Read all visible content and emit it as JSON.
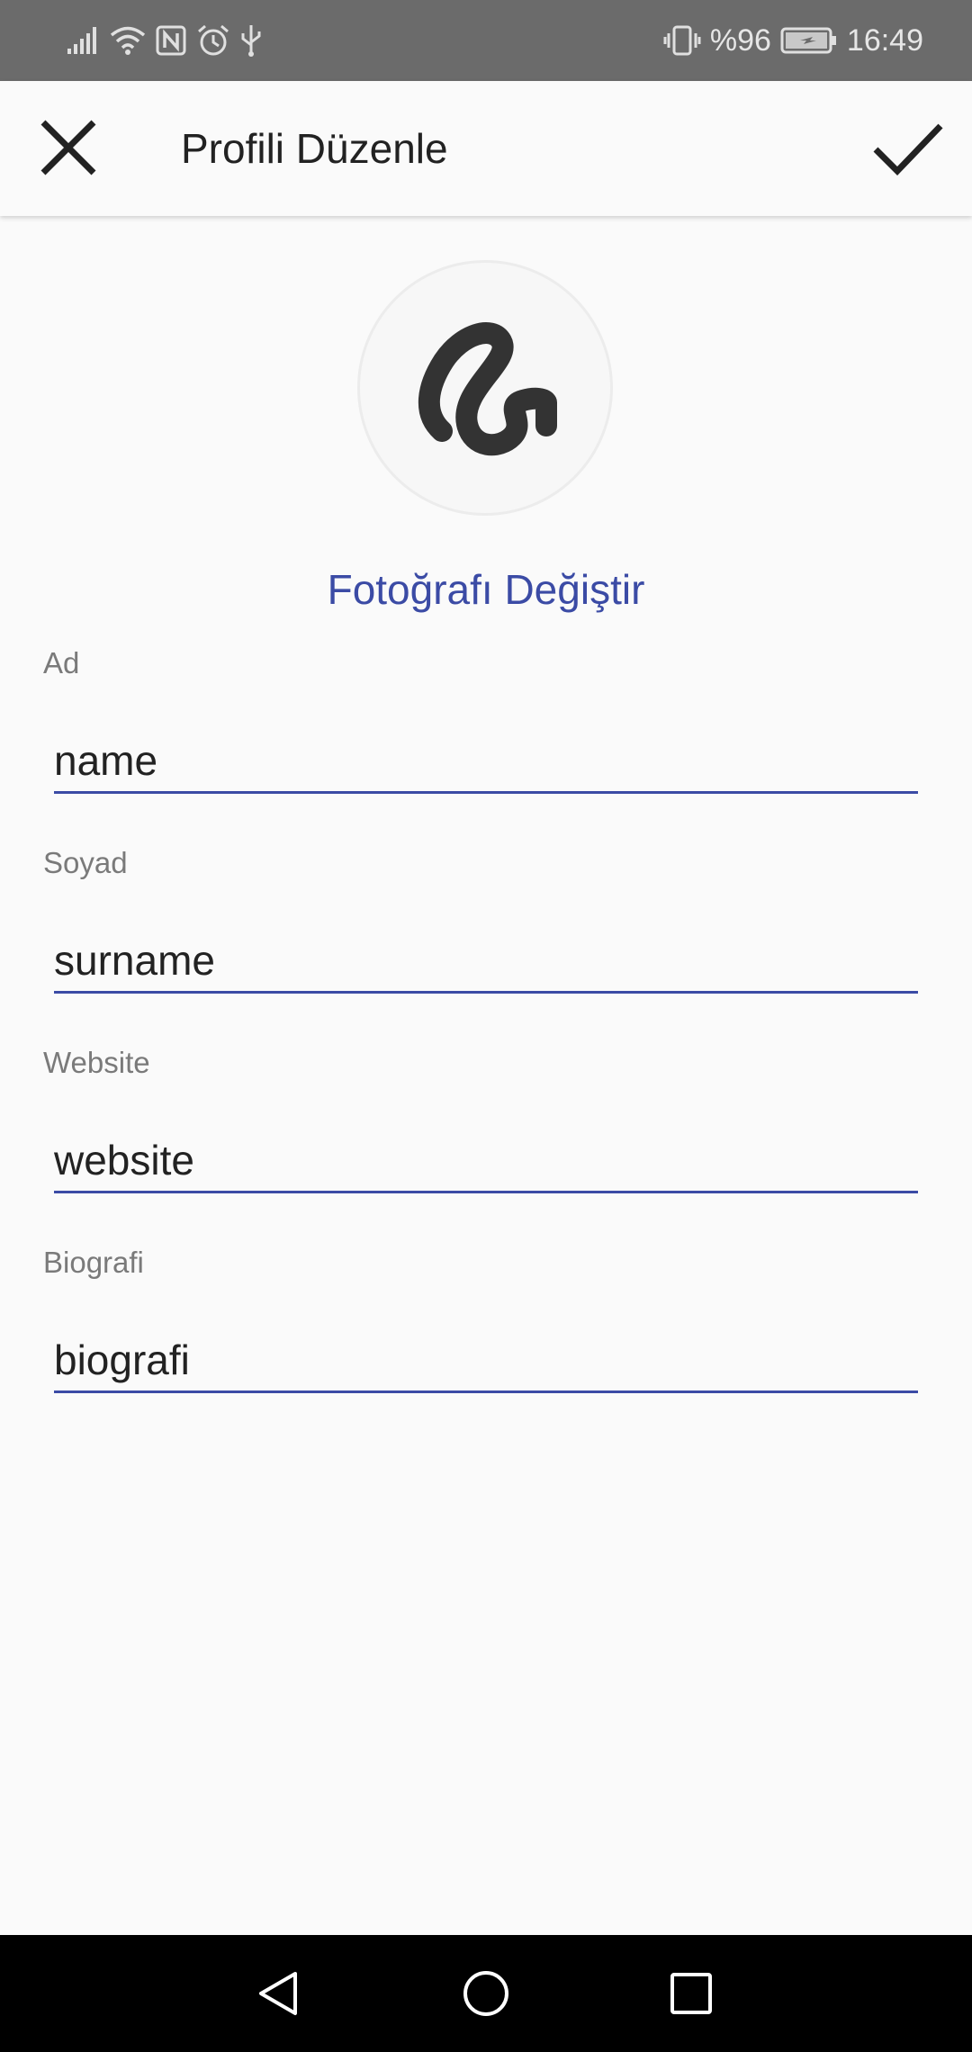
{
  "status_bar": {
    "battery": "%96",
    "time": "16:49",
    "icons": [
      "signal-icon",
      "wifi-icon",
      "nfc-icon",
      "alarm-icon",
      "usb-icon",
      "vibrate-icon",
      "battery-charging-icon"
    ]
  },
  "app_bar": {
    "title": "Profili Düzenle",
    "close_icon": "close-icon",
    "save_icon": "check-icon"
  },
  "profile": {
    "avatar_icon": "squiggle-logo-icon",
    "change_photo_label": "Fotoğrafı Değiştir"
  },
  "form": {
    "name": {
      "label": "Ad",
      "value": "name"
    },
    "surname": {
      "label": "Soyad",
      "value": "surname"
    },
    "website": {
      "label": "Website",
      "value": "website"
    },
    "bio": {
      "label": "Biografi",
      "value": "biografi"
    }
  },
  "nav_bar": {
    "icons": [
      "back-icon",
      "home-icon",
      "recents-icon"
    ]
  },
  "colors": {
    "accent": "#3b4ba5",
    "status_bar": "#6b6b6b",
    "background": "#fafafa",
    "nav_bar": "#000000"
  }
}
